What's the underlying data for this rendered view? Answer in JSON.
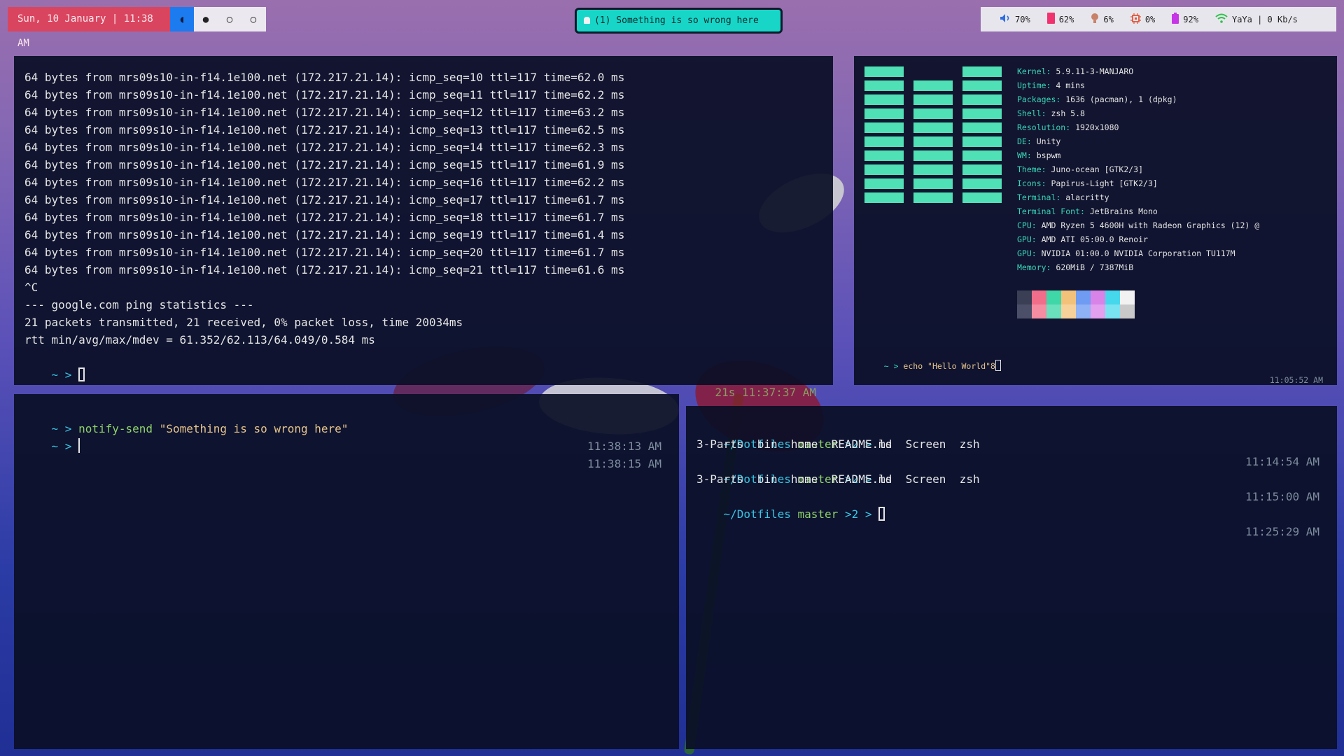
{
  "topbar": {
    "date": "Sun, 10 January | 11:38 AM",
    "workspaces": [
      {
        "glyph": "◖",
        "active": true
      },
      {
        "glyph": "●",
        "active": false
      },
      {
        "glyph": "○",
        "active": false
      },
      {
        "glyph": "○",
        "active": false
      }
    ],
    "notification": "(1) Something is so wrong here",
    "status": {
      "volume": "70%",
      "storage": "62%",
      "temp": "6%",
      "cpu": "0%",
      "battery": "92%",
      "network": "YaYa | 0 Kb/s"
    }
  },
  "ping_terminal": {
    "lines": [
      "64 bytes from mrs09s10-in-f14.1e100.net (172.217.21.14): icmp_seq=10 ttl=117 time=62.0 ms",
      "64 bytes from mrs09s10-in-f14.1e100.net (172.217.21.14): icmp_seq=11 ttl=117 time=62.2 ms",
      "64 bytes from mrs09s10-in-f14.1e100.net (172.217.21.14): icmp_seq=12 ttl=117 time=63.2 ms",
      "64 bytes from mrs09s10-in-f14.1e100.net (172.217.21.14): icmp_seq=13 ttl=117 time=62.5 ms",
      "64 bytes from mrs09s10-in-f14.1e100.net (172.217.21.14): icmp_seq=14 ttl=117 time=62.3 ms",
      "64 bytes from mrs09s10-in-f14.1e100.net (172.217.21.14): icmp_seq=15 ttl=117 time=61.9 ms",
      "64 bytes from mrs09s10-in-f14.1e100.net (172.217.21.14): icmp_seq=16 ttl=117 time=62.2 ms",
      "64 bytes from mrs09s10-in-f14.1e100.net (172.217.21.14): icmp_seq=17 ttl=117 time=61.7 ms",
      "64 bytes from mrs09s10-in-f14.1e100.net (172.217.21.14): icmp_seq=18 ttl=117 time=61.7 ms",
      "64 bytes from mrs09s10-in-f14.1e100.net (172.217.21.14): icmp_seq=19 ttl=117 time=61.4 ms",
      "64 bytes from mrs09s10-in-f14.1e100.net (172.217.21.14): icmp_seq=20 ttl=117 time=61.7 ms",
      "64 bytes from mrs09s10-in-f14.1e100.net (172.217.21.14): icmp_seq=21 ttl=117 time=61.6 ms",
      "^C",
      "--- google.com ping statistics ---",
      "21 packets transmitted, 21 received, 0% packet loss, time 20034ms",
      "rtt min/avg/max/mdev = 61.352/62.113/64.049/0.584 ms"
    ],
    "prompt": "~ >",
    "right_status": "21s 11:37:37 AM"
  },
  "neofetch": {
    "info": [
      {
        "key": "Kernel",
        "value": "5.9.11-3-MANJARO"
      },
      {
        "key": "Uptime",
        "value": "4 mins"
      },
      {
        "key": "Packages",
        "value": "1636 (pacman), 1 (dpkg)"
      },
      {
        "key": "Shell",
        "value": "zsh 5.8"
      },
      {
        "key": "Resolution",
        "value": "1920x1080"
      },
      {
        "key": "DE",
        "value": "Unity"
      },
      {
        "key": "WM",
        "value": "bspwm"
      },
      {
        "key": "Theme",
        "value": "Juno-ocean [GTK2/3]"
      },
      {
        "key": "Icons",
        "value": "Papirus-Light [GTK2/3]"
      },
      {
        "key": "Terminal",
        "value": "alacritty"
      },
      {
        "key": "Terminal Font",
        "value": "JetBrains Mono"
      },
      {
        "key": "CPU",
        "value": "AMD Ryzen 5 4600H with Radeon Graphics (12) @"
      },
      {
        "key": "GPU",
        "value": "AMD ATI 05:00.0 Renoir"
      },
      {
        "key": "GPU",
        "value": "NVIDIA 01:00.0 NVIDIA Corporation TU117M"
      },
      {
        "key": "Memory",
        "value": "620MiB / 7387MiB"
      }
    ],
    "palette_top": [
      "#3a3f55",
      "#f06e8a",
      "#3fd6a8",
      "#f3c27a",
      "#6f9bf2",
      "#d883e8",
      "#45d8ec",
      "#f2f2f2"
    ],
    "palette_bottom": [
      "#4b5068",
      "#f48ca2",
      "#6ae0bd",
      "#f6d199",
      "#8fb1f5",
      "#e2a0ee",
      "#79e3f1",
      "#c9c9c9"
    ],
    "prompt": "~ >",
    "command": "echo \"Hello World\"8",
    "time": "11:05:52 AM"
  },
  "notify_terminal": {
    "prompt": "~ >",
    "command": "notify-send",
    "argument": "\"Something is so wrong here\"",
    "time1": "11:38:13 AM",
    "time2": "11:38:15 AM"
  },
  "dotfiles_terminal": {
    "path": "~/Dotfiles",
    "branch": "master",
    "suffix": ">2 >",
    "command": "ls",
    "output": "3-Parts  bin  home  README.md  Screen  zsh",
    "time1": "11:14:54 AM",
    "time2": "11:15:00 AM",
    "time3": "11:25:29 AM"
  }
}
